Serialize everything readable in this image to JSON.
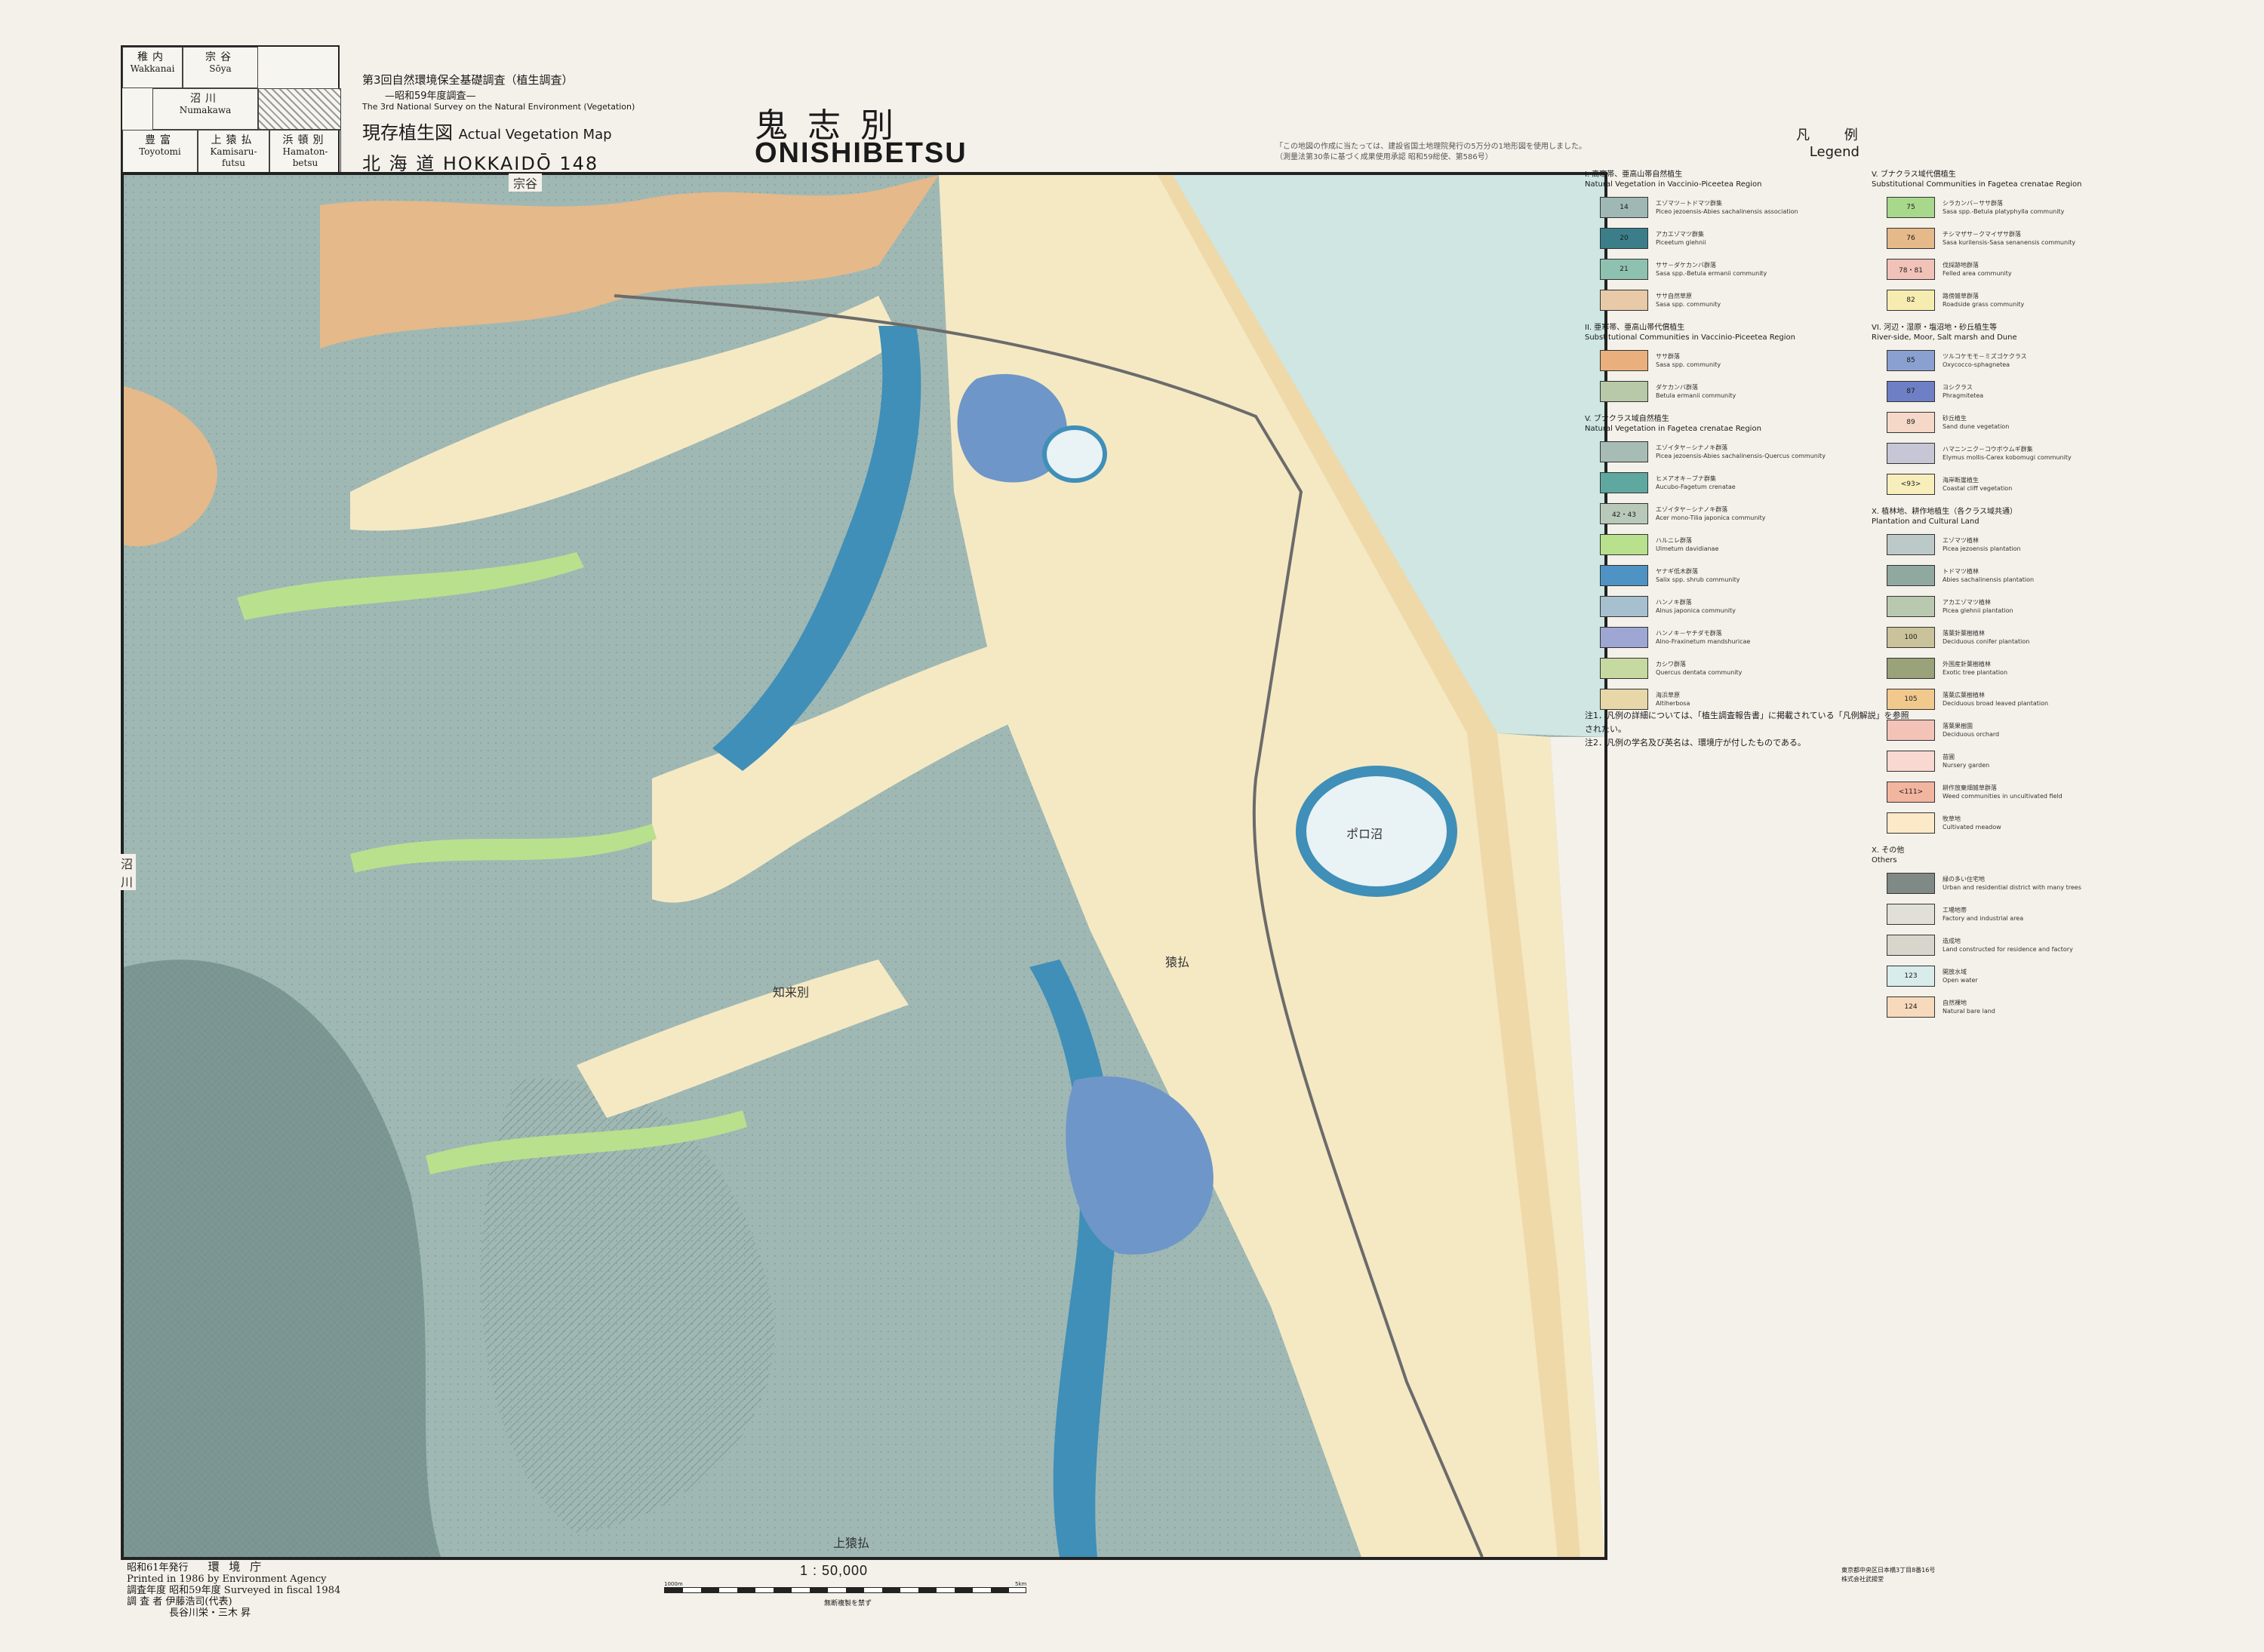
{
  "header": {
    "survey_line1": "第3回自然環境保全基礎調査（植生調査）",
    "survey_line2": "—昭和59年度調査—",
    "survey_line3": "The 3rd National Survey on the Natural Environment (Vegetation)",
    "map_kind_jp": "現存植生図",
    "map_kind_en": "Actual Vegetation Map",
    "region_line": "北 海 道 HOKKAIDŌ 148",
    "title_jp": "鬼志別",
    "title_en": "ONISHIBETSU",
    "legend_jp": "凡 例",
    "legend_en": "Legend",
    "source_note": "「この地図の作成に当たっては、建設省国土地理院発行の5万分の1地形図を使用しました。（測量法第30条に基づく成果使用承認 昭和59総使、第586号）"
  },
  "index_map": {
    "cells": [
      {
        "jp": "稚内",
        "en": "Wakkanai"
      },
      {
        "jp": "宗谷",
        "en": "Sōya"
      },
      {
        "jp": "沼川",
        "en": "Numakawa"
      },
      {
        "jp": "豊富",
        "en": "Toyotomi"
      },
      {
        "jp": "上猿払",
        "en": "Kamisaru-futsu"
      },
      {
        "jp": "浜頓別",
        "en": "Hamaton-betsu"
      }
    ]
  },
  "map": {
    "labels": {
      "top": "宗谷",
      "bottom": "上猿払",
      "left": "沼川",
      "lake1": "ポロ沼",
      "lake2": "猿払",
      "area1": "知来別"
    },
    "colors": {
      "sea": "#cfe6e2",
      "spruce_forest": "#9fb8b4",
      "mixed_forest": "#a9bcc0",
      "river_forest": "#3f8fb8",
      "marsh": "#6e96c8",
      "meadow": "#f5e9c4",
      "grassland": "#e5b98a",
      "willow": "#b9e08d",
      "lake": "#e9f2f4",
      "dark_forest": "#6f8f8a"
    }
  },
  "legend": {
    "sections_col1": [
      {
        "title": "I. 高寒帯、亜高山帯自然植生\nNatural Vegetation in Vaccinio-Piceetea Region",
        "items": [
          {
            "code": "14",
            "color": "#9fb8b4",
            "text": "エゾマツ－トドマツ群集\nPiceo jezoensis-Abies sachalinensis association"
          },
          {
            "code": "20",
            "color": "#3b7e8a",
            "text": "アカエゾマツ群集\nPiceetum glehnii"
          },
          {
            "code": "21",
            "color": "#8fc1b0",
            "text": "ササ－ダケカンバ群落\nSasa spp.-Betula ermanii community"
          },
          {
            "code": "",
            "color": "#e8c9a8",
            "text": "ササ自然草原\nSasa spp. community"
          }
        ]
      },
      {
        "title": "II. 亜寒帯、亜高山帯代償植生\nSubstitutional Communities in Vaccinio-Piceetea Region",
        "items": [
          {
            "code": "",
            "color": "#e9b07d",
            "text": "ササ群落\nSasa spp. community"
          },
          {
            "code": "",
            "color": "#b7c9a8",
            "text": "ダケカンバ群落\nBetula ermanii community"
          }
        ]
      },
      {
        "title": "V. ブナクラス域自然植生\nNatural Vegetation in Fagetea crenatae Region",
        "items": [
          {
            "code": "",
            "color": "#a8bcb6",
            "text": "エゾイタヤ－シナノキ群落\nPicea jezoensis-Abies sachalinensis-Quercus community"
          },
          {
            "code": "",
            "color": "#5fa8a0",
            "text": "ヒメアオキ－ブナ群集\nAucubo-Fagetum crenatae"
          },
          {
            "code": "42・43",
            "color": "#b9c9b9",
            "text": "エゾイタヤ－シナノキ群落\nAcer mono-Tilia japonica community"
          },
          {
            "code": "",
            "color": "#b9e08d",
            "text": "ハルニレ群落\nUlmetum davidianae"
          },
          {
            "code": "",
            "color": "#4e93c4",
            "text": "ヤナギ低木群落\nSalix spp. shrub community"
          },
          {
            "code": "",
            "color": "#a7c0cf",
            "text": "ハンノキ群落\nAlnus japonica community"
          },
          {
            "code": "",
            "color": "#9ea6d3",
            "text": "ハンノキ－ヤチダモ群落\nAlno-Fraxinetum mandshuricae"
          },
          {
            "code": "",
            "color": "#c6d9a0",
            "text": "カシワ群落\nQuercus dentata community"
          },
          {
            "code": "",
            "color": "#e8d7a8",
            "text": "海浜草原\nAltiherbosa"
          }
        ]
      }
    ],
    "sections_col2": [
      {
        "title": "V. ブナクラス域代償植生\nSubstitutional Communities in Fagetea crenatae Region",
        "items": [
          {
            "code": "75",
            "color": "#a8d88c",
            "text": "シラカンバ－ササ群落\nSasa spp.-Betula platyphylla community"
          },
          {
            "code": "76",
            "color": "#e5b98a",
            "text": "チシマザサ－クマイザサ群落\nSasa kurilensis-Sasa senanensis community"
          },
          {
            "code": "78・81",
            "color": "#f1c2b8",
            "text": "伐採跡地群落\nFelled area community"
          },
          {
            "code": "82",
            "color": "#f7ecb0",
            "text": "路傍雑草群落\nRoadside grass community"
          }
        ]
      },
      {
        "title": "VI. 河辺・湿原・塩沼地・砂丘植生等\nRiver-side, Moor, Salt marsh and Dune",
        "items": [
          {
            "code": "85",
            "color": "#8aa0d0",
            "text": "ツルコケモモ－ミズゴケクラス\nOxycocco-sphagnetea"
          },
          {
            "code": "87",
            "color": "#6e7fc6",
            "text": "ヨシクラス\nPhragmitetea"
          },
          {
            "code": "89",
            "color": "#f6d8c8",
            "text": "砂丘植生\nSand dune vegetation"
          },
          {
            "code": "",
            "color": "#c6c6d6",
            "text": "ハマニンニク－コウボウムギ群集\nElymus mollis-Carex kobomugi community"
          },
          {
            "code": "<93>",
            "color": "#f7eebc",
            "text": "海岸断崖植生\nCoastal cliff vegetation"
          }
        ]
      },
      {
        "title": "X. 植林地、耕作地植生（各クラス域共通）\nPlantation and Cultural Land",
        "items": [
          {
            "code": "",
            "color": "#bcc9c9",
            "text": "エゾマツ植林\nPicea jezoensis plantation"
          },
          {
            "code": "",
            "color": "#8fa8a0",
            "text": "トドマツ植林\nAbies sachalinensis plantation"
          },
          {
            "code": "",
            "color": "#b9c9b0",
            "text": "アカエゾマツ植林\nPicea glehnii plantation"
          },
          {
            "code": "100",
            "color": "#c9c29a",
            "text": "落葉針葉樹植林\nDeciduous conifer plantation"
          },
          {
            "code": "",
            "color": "#9aa27a",
            "text": "外国産針葉樹植林\nExotic tree plantation"
          },
          {
            "code": "105",
            "color": "#f2c98d",
            "text": "落葉広葉樹植林\nDeciduous broad leaved plantation"
          },
          {
            "code": "",
            "color": "#f3c3b8",
            "text": "落葉果樹園\nDeciduous orchard"
          },
          {
            "code": "",
            "color": "#f8d8d0",
            "text": "苗圃\nNursery garden"
          },
          {
            "code": "<111>",
            "color": "#f2b5a0",
            "text": "耕作放棄畑雑草群落\nWeed communities in uncultivated field"
          },
          {
            "code": "",
            "color": "#fbe9c8",
            "text": "牧草地\nCultivated meadow"
          }
        ]
      },
      {
        "title": "X. その他\nOthers",
        "items": [
          {
            "code": "",
            "color": "#7f8a86",
            "text": "緑の多い住宅地\nUrban and residential district with many trees"
          },
          {
            "code": "",
            "color": "#e0e0d8",
            "text": "工場地帯\nFactory and industrial area"
          },
          {
            "code": "",
            "color": "#d8d6cc",
            "text": "造成地\nLand constructed for residence and factory"
          },
          {
            "code": "123",
            "color": "#d8ecec",
            "text": "開放水域\nOpen water"
          },
          {
            "code": "124",
            "color": "#f7d9bc",
            "text": "自然裸地\nNatural bare land"
          }
        ]
      }
    ],
    "note1": "注1．凡例の詳細については、「植生調査報告書」に掲載されている「凡例解説」を参照されたい。",
    "note2": "注2．凡例の学名及び英名は、環境庁が付したものである。"
  },
  "footer": {
    "publish_jp": "昭和61年発行",
    "agency_jp": "環 境 庁",
    "printed": "Printed in 1986 by Environment Agency",
    "surveyed": "調査年度 昭和59年度 Surveyed in fiscal 1984",
    "surveyor1": "調 査 者 伊藤浩司(代表)",
    "surveyor2": "長谷川栄・三木 昇",
    "scale": "1 : 50,000",
    "scale_note": "無断複製を禁ず",
    "scale_left": "1000m",
    "scale_right": "5km",
    "printer1": "東京都中央区日本橋3丁目8番16号",
    "printer2": "株式会社武揚堂"
  }
}
